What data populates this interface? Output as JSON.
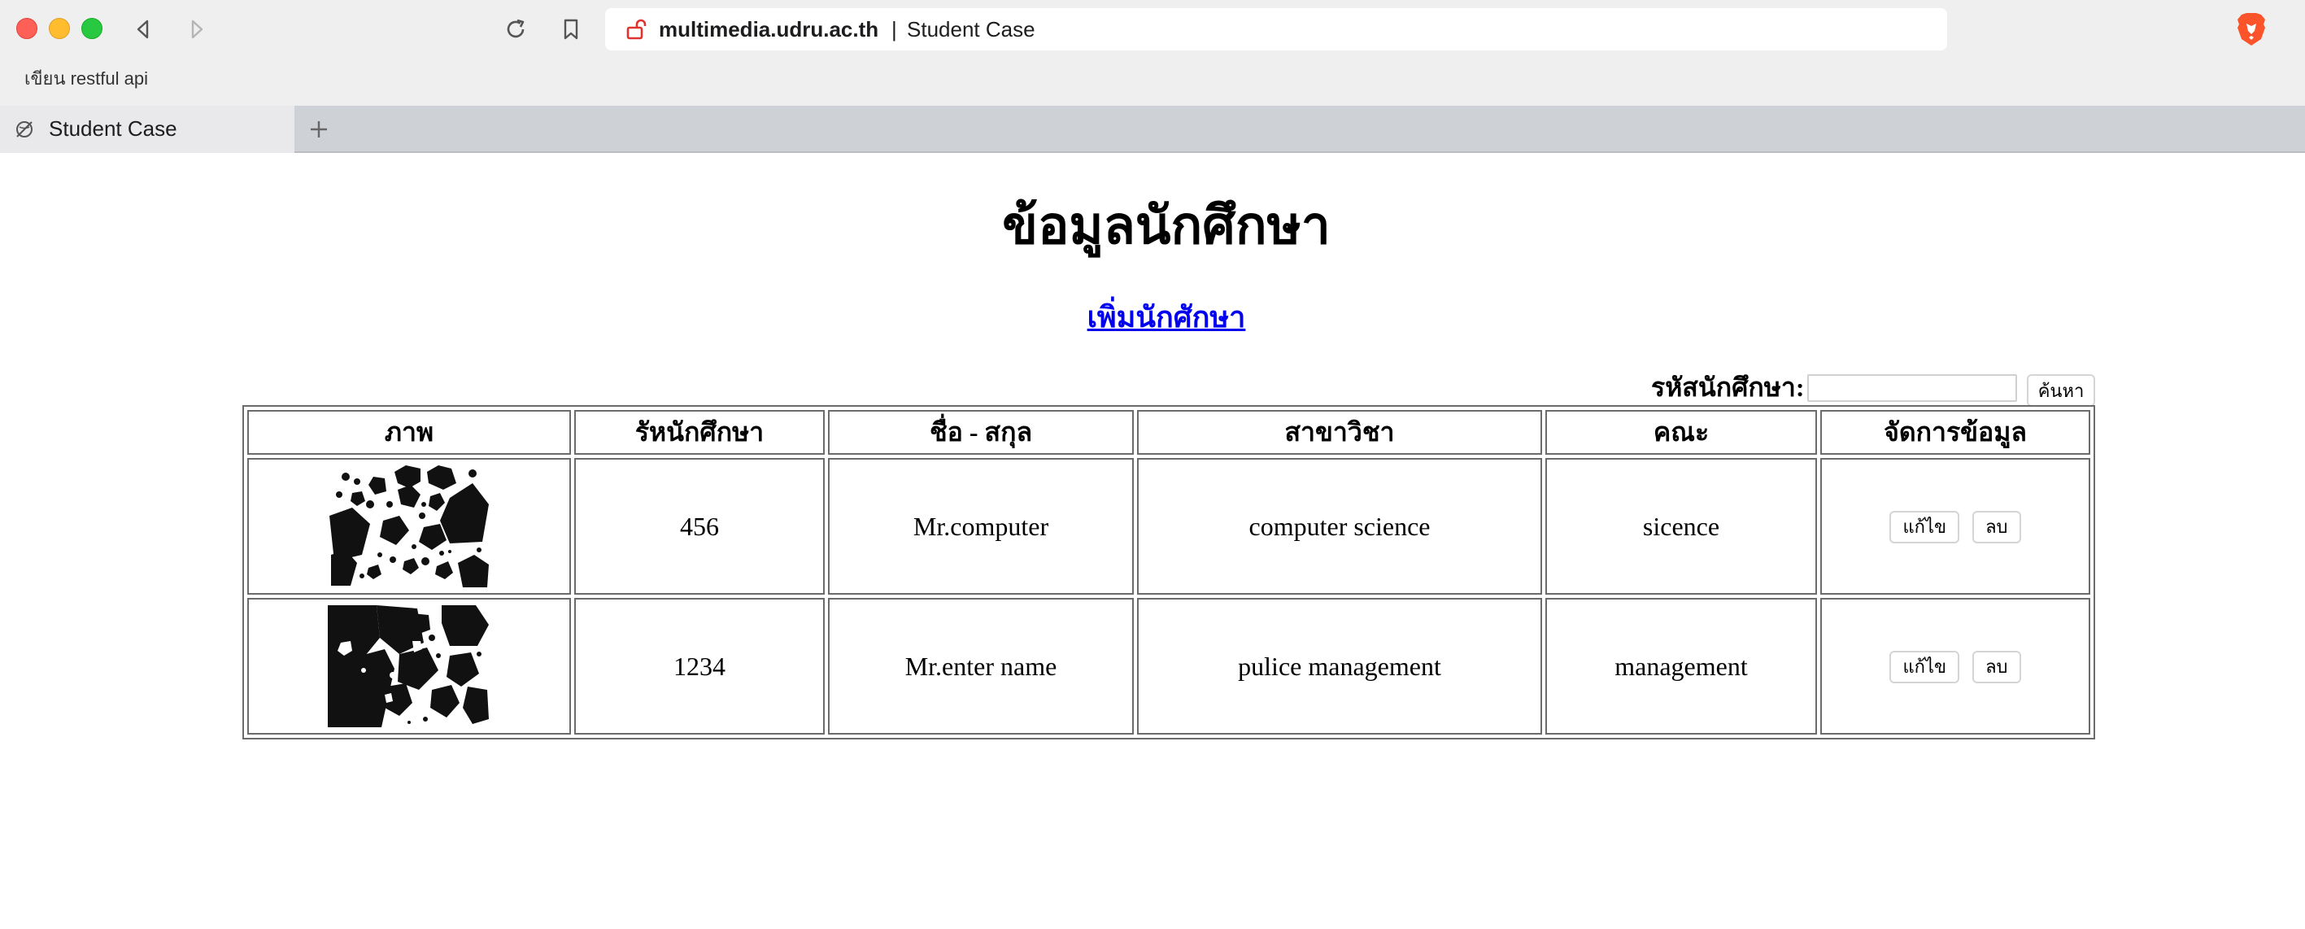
{
  "browser": {
    "url_host": "multimedia.udru.ac.th",
    "url_separator": "|",
    "url_page_title": "Student Case",
    "bookmark": "เขียน restful api",
    "tab_title": "Student Case",
    "icons": [
      "back-icon",
      "forward-icon",
      "reload-icon",
      "bookmark-icon",
      "insecure-lock-icon",
      "brave-lion-icon",
      "new-tab-plus-icon"
    ]
  },
  "page": {
    "title": "ข้อมูลนักศึกษา",
    "add_link": "เพิ่มนักศักษา",
    "search": {
      "label": "รหัสนักศึกษา:",
      "value": "",
      "button": "ค้นหา"
    },
    "table": {
      "headers": [
        "ภาพ",
        "รัหนักศึกษา",
        "ชื่อ - สกุล",
        "สาขาวิชา",
        "คณะ",
        "จัดการข้อมูล"
      ],
      "rows": [
        {
          "id": "456",
          "name": "Mr.computer",
          "major": "computer science",
          "faculty": "sicence",
          "edit": "แก้ไข",
          "delete": "ลบ"
        },
        {
          "id": "1234",
          "name": "Mr.enter name",
          "major": "pulice management",
          "faculty": "management",
          "edit": "แก้ไข",
          "delete": "ลบ"
        }
      ]
    }
  },
  "colors": {
    "link": "#0000ee",
    "toolbar_bg": "#efeff0",
    "tabstrip_bg": "#ced1d6",
    "insecure_icon": "#e0322e",
    "brave_orange": "#fb542b"
  }
}
